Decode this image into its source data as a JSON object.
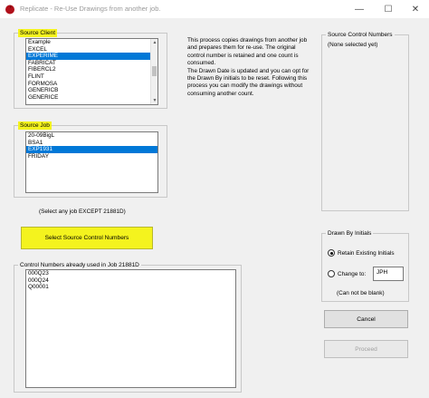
{
  "window": {
    "title": "Replicate - Re-Use Drawings from another job."
  },
  "colors": {
    "highlight": "#f4f31e",
    "selection": "#0078d7"
  },
  "source_client": {
    "label": "Source Client",
    "items": [
      "Example",
      "EXCEL",
      "EXPERIME",
      "FABRICAT",
      "FIBERCL2",
      "FLINT",
      "FORMOSA",
      "GENERICB",
      "GENERICE"
    ],
    "selected": "EXPERIME"
  },
  "source_job": {
    "label": "Source Job",
    "items": [
      "20-09BigL",
      "BSA1",
      "EXP1931",
      "FRIDAY"
    ],
    "selected": "EXP1931"
  },
  "hint_text": "(Select any job EXCEPT 21881D)",
  "info_text": "This process copies drawings from another job and prepares them for re-use. The original control number is retained and one count is consumed.\nThe Drawn Date is updated and you can opt for the Drawn By initials to be reset. Following this process you can modify the drawings without consuming another count.",
  "select_button": {
    "label": "Select Source Control Numbers"
  },
  "used_numbers": {
    "label": "Control Numbers already used in Job 21881D",
    "items": [
      "000Q23",
      "000Q24",
      "Q00001"
    ]
  },
  "source_control_numbers": {
    "label": "Source Control Numbers",
    "empty_text": "(None selected yet)"
  },
  "drawn_by": {
    "label": "Drawn By Initials",
    "retain_label": "Retain Existing Initials",
    "change_label": "Change to:",
    "initials_value": "JPH",
    "note": "(Can not be blank)",
    "selected_option": "retain"
  },
  "buttons": {
    "cancel": "Cancel",
    "proceed": "Proceed"
  }
}
